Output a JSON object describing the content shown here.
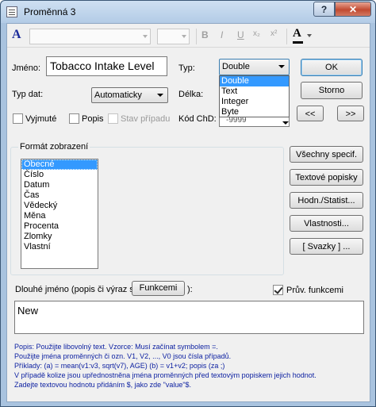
{
  "window": {
    "title": "Proměnná 3",
    "help_label": "?",
    "close_label": "✕"
  },
  "toolbar": {
    "font_icon": "A",
    "bold": "B",
    "italic": "I",
    "underline": "U",
    "subscript": "x₂",
    "superscript": "x²",
    "color_icon": "A"
  },
  "form": {
    "name_label": "Jméno:",
    "name_value": "Tobacco Intake Level",
    "type_label": "Typ:",
    "type_value": "Double",
    "data_type_label": "Typ dat:",
    "data_type_value": "Automaticky",
    "length_label": "Délka:",
    "code_label": "Kód ChD:",
    "code_value": "-9999",
    "excluded_label": "Vyjmuté",
    "label_label": "Popis",
    "case_state_label": "Stav případu"
  },
  "type_dropdown": {
    "options": [
      "Double",
      "Text",
      "Integer",
      "Byte"
    ]
  },
  "buttons": {
    "ok": "OK",
    "cancel": "Storno",
    "prev": "<<",
    "next": ">>",
    "all_specs": "Všechny specif.",
    "text_labels": "Textové popisky",
    "values_stats": "Hodn./Statist...",
    "properties": "Vlastnosti...",
    "links": "[ Svazky ] ...",
    "functions": "Funkcemi"
  },
  "format": {
    "group_label": "Formát zobrazení",
    "items": [
      "Obecné",
      "Číslo",
      "Datum",
      "Čas",
      "Vědecký",
      "Měna",
      "Procenta",
      "Zlomky",
      "Vlastní"
    ]
  },
  "long_name": {
    "label_prefix": "Dlouhé jméno (popis či výraz s",
    "label_suffix": "):",
    "functions_check_label": "Prův. funkcemi",
    "value": "New"
  },
  "help": {
    "lines": [
      "Popis: Použijte libovolný text. Vzorce: Musí začínat symbolem =.",
      "Použijte jména proměnných či ozn. V1, V2, ..., V0 jsou čísla případů.",
      "Příklady: (a) = mean(v1:v3, sqrt(v7), AGE) (b) = v1+v2; popis (za ;)",
      "V případě kolize jsou upřednostněna jména proměnných před textovým popiskem jejich hodnot.",
      "Zadejte textovou hodnotu přidáním $, jako zde \"value\"$."
    ]
  }
}
